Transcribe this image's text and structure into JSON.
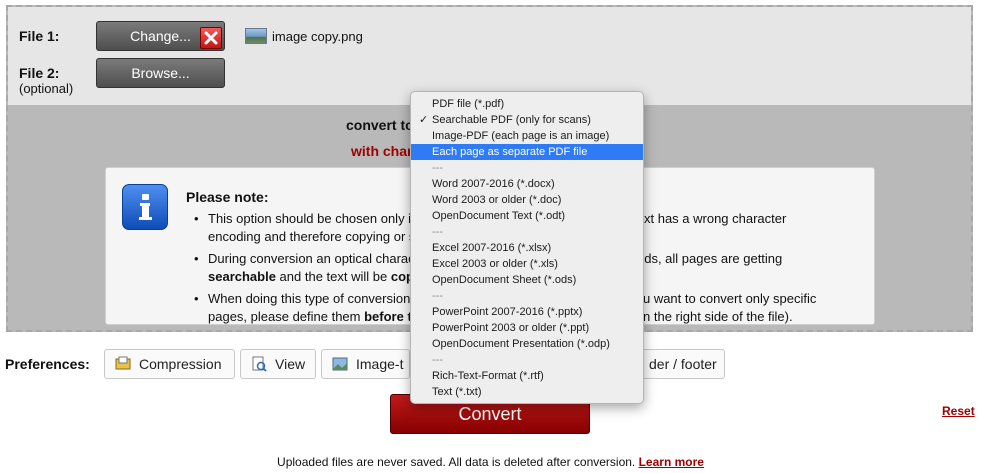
{
  "files": {
    "file1_label": "File 1:",
    "file1_button": "Change...",
    "file1_name": "image copy.png",
    "file2_label": "File 2:",
    "file2_optional": "(optional)",
    "file2_button": "Browse..."
  },
  "convert_to_label": "convert to",
  "with_char_label": "with char",
  "note": {
    "title": "Please note:",
    "b1_part1": "This option should be chosen only i",
    "b1_part2": "he text has a wrong character",
    "b1_part3": "encoding and therefore copying or s",
    "b2_part1": "During conversion an optical charac",
    "b2_part2": "ards, all pages are getting",
    "b2_bold1": "searchable",
    "b2_part3": " and the text will be ",
    "b2_bold2": "cop",
    "b3_part1": "When doing this type of conversion,",
    "b3_part2": "d. If you want to convert only specific",
    "b3_part3": "pages, please define them ",
    "b3_bold": "before t",
    "b3_part4": "on the right side of the file)."
  },
  "dropdown": {
    "items": [
      {
        "label": "PDF file (*.pdf)"
      },
      {
        "label": "Searchable PDF (only for scans)",
        "checked": true
      },
      {
        "label": "Image-PDF (each page is an image)"
      },
      {
        "label": "Each page as separate PDF file",
        "highlighted": true
      },
      {
        "label": "---"
      },
      {
        "label": "Word 2007-2016 (*.docx)"
      },
      {
        "label": "Word 2003 or older (*.doc)"
      },
      {
        "label": "OpenDocument Text (*.odt)"
      },
      {
        "label": "---"
      },
      {
        "label": "Excel 2007-2016 (*.xlsx)"
      },
      {
        "label": "Excel 2003 or older (*.xls)"
      },
      {
        "label": "OpenDocument Sheet (*.ods)"
      },
      {
        "label": "---"
      },
      {
        "label": "PowerPoint 2007-2016 (*.pptx)"
      },
      {
        "label": "PowerPoint 2003 or older (*.ppt)"
      },
      {
        "label": "OpenDocument Presentation (*.odp)"
      },
      {
        "label": "---"
      },
      {
        "label": "Rich-Text-Format (*.rtf)"
      },
      {
        "label": "Text (*.txt)"
      }
    ]
  },
  "preferences": {
    "label": "Preferences:",
    "compression": "Compression",
    "view": "View",
    "image": "Image-t",
    "header_footer": "der / footer"
  },
  "convert_button": "Convert",
  "reset_link": "Reset",
  "footer": {
    "text": "Uploaded files are never saved. All data is deleted after conversion. ",
    "link": "Learn more"
  },
  "colors": {
    "accent_red": "#a00000",
    "highlight_blue": "#2f7bf5"
  },
  "icons": {
    "remove": "close-icon",
    "file": "image-file-icon",
    "info": "info-icon",
    "check": "checkmark-icon"
  }
}
